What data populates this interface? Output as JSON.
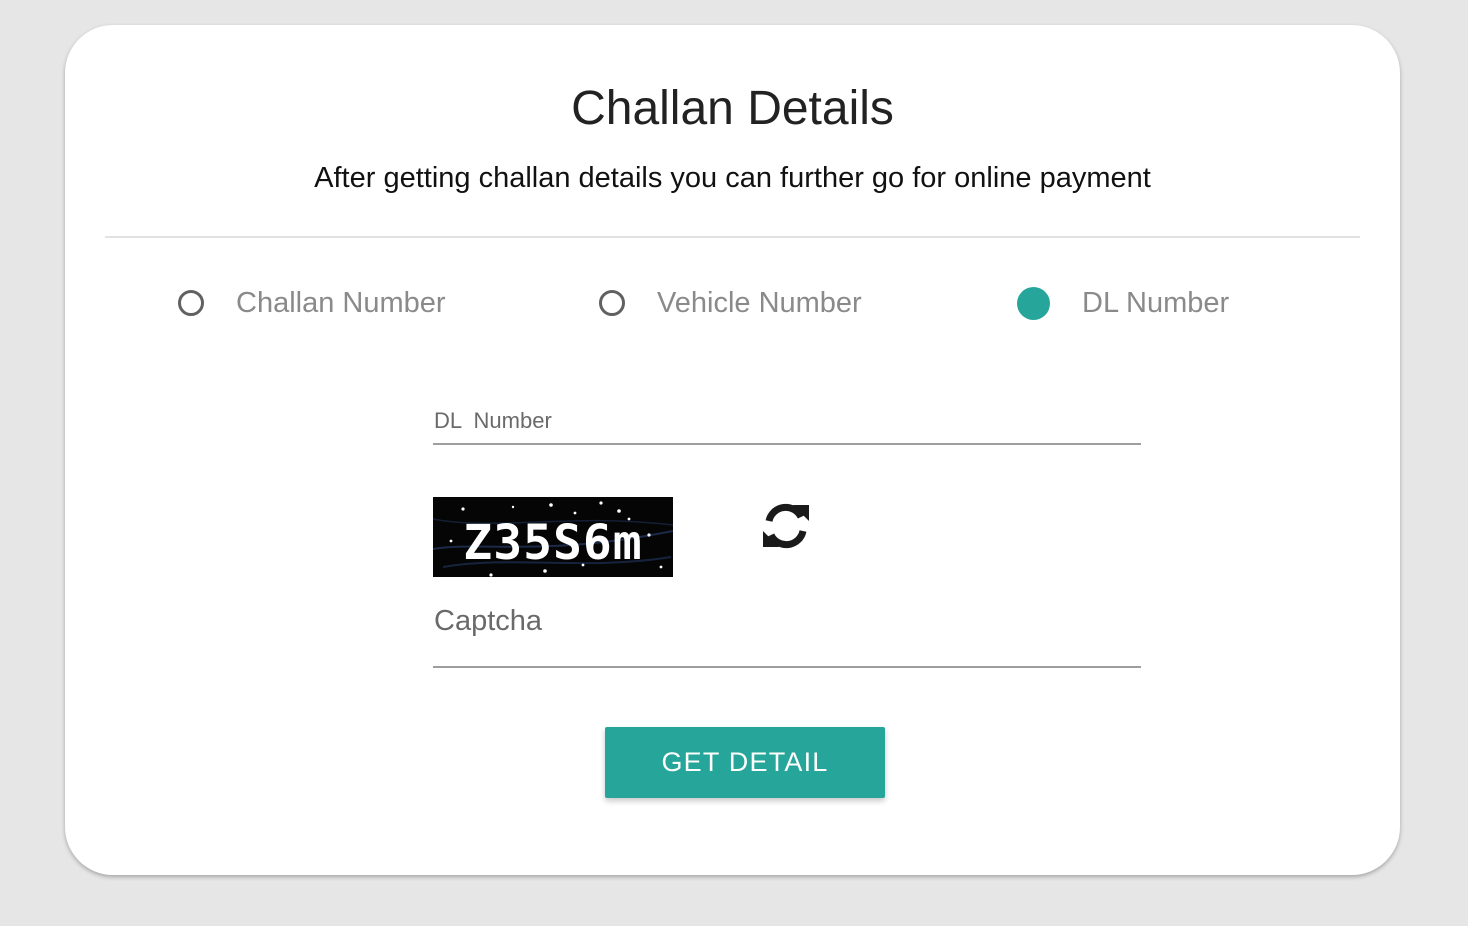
{
  "header": {
    "title": "Challan Details",
    "subtitle": "After getting challan details you can further go for online payment"
  },
  "search_type": {
    "options": [
      {
        "label": "Challan Number",
        "checked": false
      },
      {
        "label": "Vehicle Number",
        "checked": false
      },
      {
        "label": "DL Number",
        "checked": true
      }
    ]
  },
  "form": {
    "dl_label": "DL  Number",
    "dl_value": "",
    "captcha_text": "Z35S6m",
    "captcha_label": "Captcha",
    "captcha_value": "",
    "submit_label": "GET DETAIL"
  },
  "colors": {
    "accent": "#26a69a",
    "background": "#e6e6e6",
    "card": "#ffffff"
  },
  "icons": {
    "refresh": "refresh-icon"
  }
}
